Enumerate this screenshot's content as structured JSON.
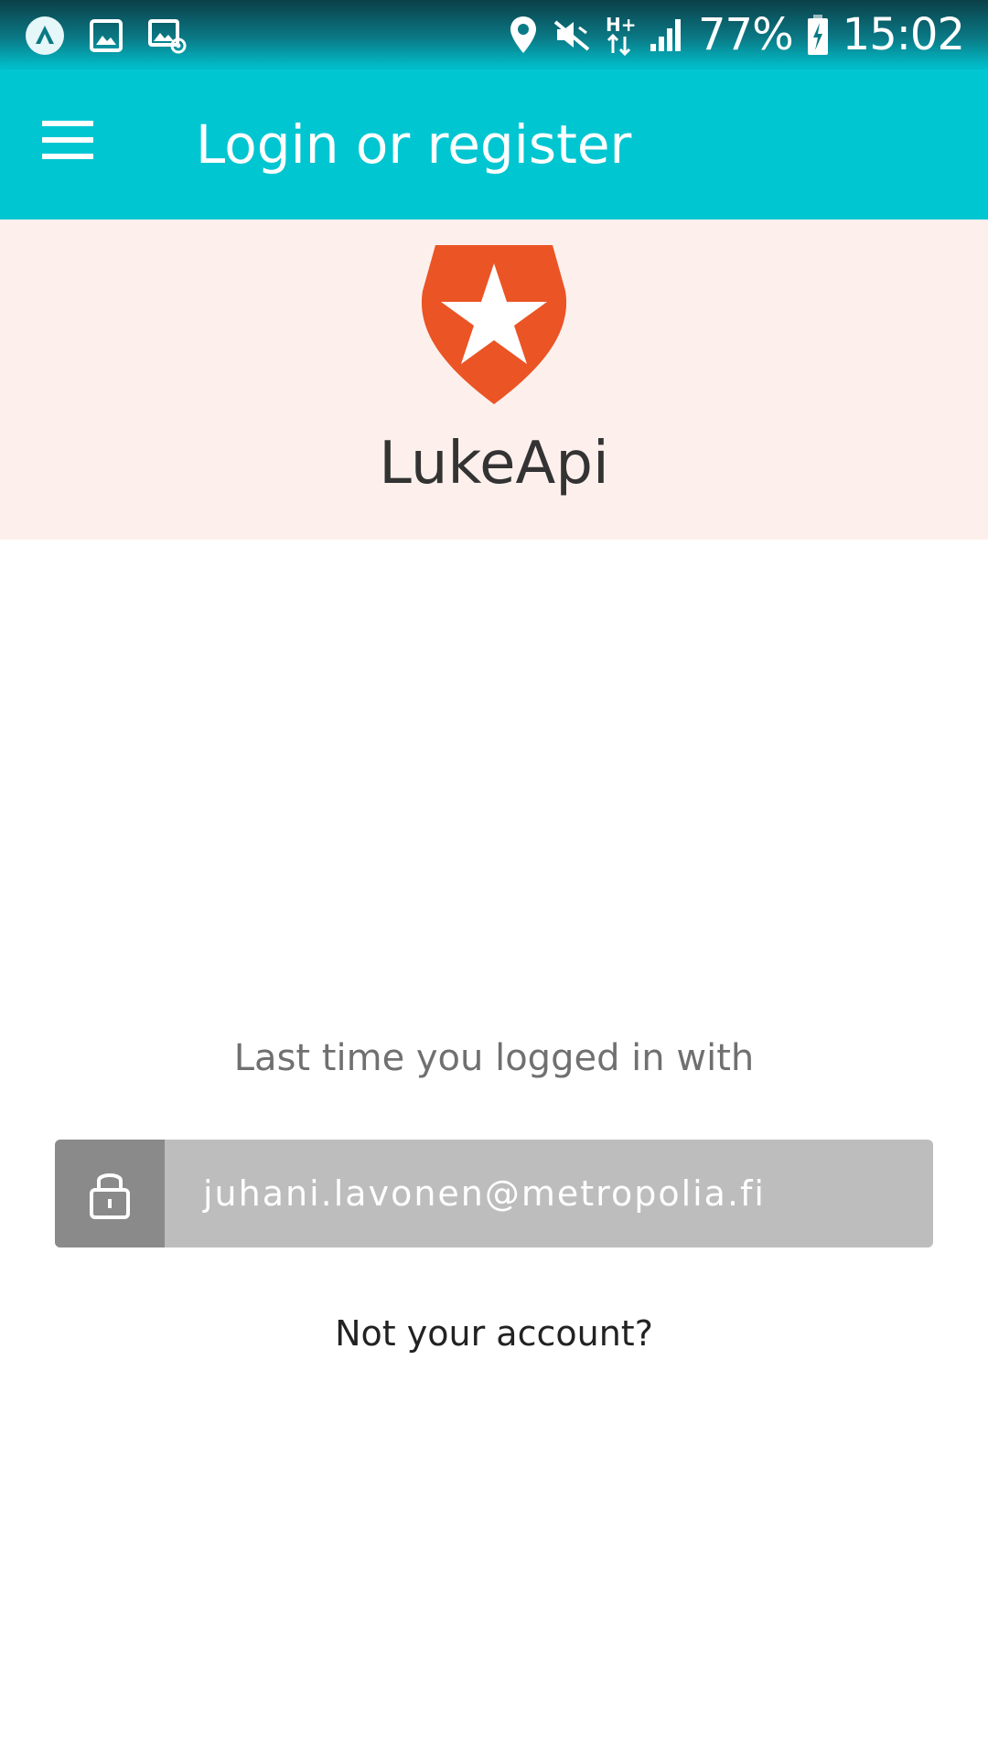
{
  "status_bar": {
    "left_icons": [
      "app-notification-icon",
      "image-notification-icon",
      "email-notification-icon"
    ],
    "right_icons": [
      "location-icon",
      "mute-icon",
      "network-h-plus-icon",
      "signal-icon"
    ],
    "network_type": "H+",
    "battery_percent": "77%",
    "time": "15:02"
  },
  "app_bar": {
    "title": "Login or register",
    "background_color": "#00c6d2"
  },
  "brand": {
    "name": "LukeApi",
    "logo_icon": "shield-star-logo",
    "logo_color": "#eb5424",
    "header_background": "#fdf0ec"
  },
  "login": {
    "caption": "Last time you logged in with",
    "account_email": "juhani.lavonen@metropolia.fi",
    "account_icon": "lock-icon",
    "not_your_account": "Not your account?"
  }
}
